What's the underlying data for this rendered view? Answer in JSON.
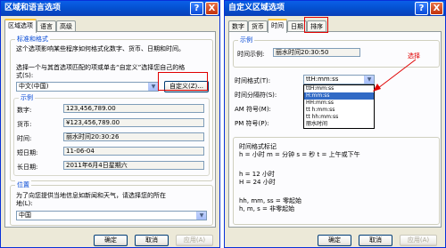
{
  "left": {
    "title": "区域和语言选项",
    "help": "?",
    "close": "X",
    "tabs": [
      "区域选项",
      "语言",
      "高级"
    ],
    "group1_title": "标准和格式",
    "desc1": "这个选项影响某些程序如何格式化数字、货币、日期和时间。",
    "desc2_a": "选择一个与其首选项匹配的项或单击“自定义”选择您自己的格",
    "desc2_b": "式(S):",
    "locale": "中文(中国)",
    "customize_btn": "自定义(Z)...",
    "samples_title": "示例",
    "samples": [
      {
        "label": "数字:",
        "value": "123,456,789.00"
      },
      {
        "label": "货币:",
        "value": "¥123,456,789.00"
      },
      {
        "label": "时间:",
        "value": "丽水时间20:30:26"
      },
      {
        "label": "短日期:",
        "value": "11-06-04"
      },
      {
        "label": "长日期:",
        "value": "2011年6月4日星期六"
      }
    ],
    "group2_title": "位置",
    "loc_desc_a": "为了向您提供当地信息如新闻和天气，请选择您的所在",
    "loc_desc_b": "地(L):",
    "location": "中国",
    "ok": "确定",
    "cancel": "取消",
    "apply": "应用(A)"
  },
  "right": {
    "title": "自定义区域选项",
    "help": "?",
    "close": "X",
    "tabs": [
      "数字",
      "货币",
      "时间",
      "日期",
      "排序"
    ],
    "samples_title": "示例",
    "time_sample_label": "时间示例:",
    "time_sample_value": "丽水时间20:30:50",
    "time_format_label": "时间格式(T):",
    "time_format_value": "ttH:mm:ss",
    "time_sep_label": "时间分隔符(S):",
    "am_label": "AM 符号(M):",
    "pm_label": "PM 符号(P):",
    "dropdown_items": [
      "ttH:mm:ss",
      "H:mm:ss",
      "HH:mm:ss",
      "tt h:mm:ss",
      "tt hh:mm:ss",
      "丽水时间"
    ],
    "dropdown_selected": 1,
    "annotation": "选择",
    "notation_title": "时间格式标记",
    "notation_lines": [
      "h = 小时      m = 分钟      s = 秒      t = 上午或下午",
      "h = 12 小时",
      "H = 24 小时",
      "hh, mm, ss = 零起始",
      "h, m, s = 非零起始"
    ],
    "ok": "确定",
    "cancel": "取消",
    "apply": "应用(A)"
  },
  "colors": {
    "titlebar": "#0450D0",
    "annotation": "#E00000",
    "selection": "#316AC5"
  }
}
